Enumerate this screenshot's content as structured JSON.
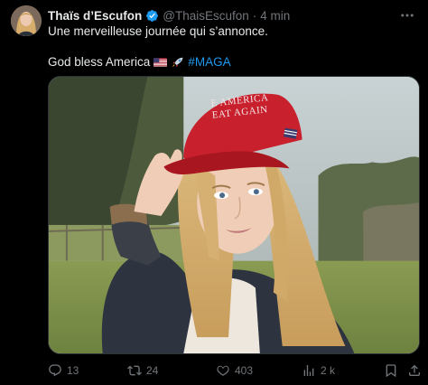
{
  "author": {
    "display_name": "Thaïs d’Escufon",
    "handle": "@ThaisEscufon",
    "separator": "·",
    "time": "4 min",
    "verified": true
  },
  "tweet": {
    "line1": "Une merveilleuse journée qui s’annonce.",
    "line2_text": "God bless America",
    "line2_emojis": [
      "us-flag-icon",
      "rocket-icon"
    ],
    "hashtag": "#MAGA"
  },
  "photo": {
    "cap_text_line1": "E AMERICA",
    "cap_text_line2": "EAT AGAIN"
  },
  "actions": {
    "reply_count": "13",
    "retweet_count": "24",
    "like_count": "403",
    "views_count": "2 k"
  },
  "colors": {
    "background": "#000000",
    "text": "#e7e9ea",
    "secondary": "#71767b",
    "accent": "#1d9bf0"
  }
}
